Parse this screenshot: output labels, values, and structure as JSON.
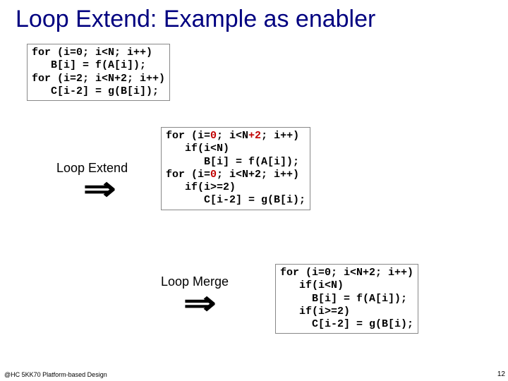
{
  "title": "Loop Extend: Example as enabler",
  "code_box_1": "for (i=0; i<N; i++)\n   B[i] = f(A[i]);\nfor (i=2; i<N+2; i++)\n   C[i-2] = g(B[i]);",
  "step1_label": "Loop Extend",
  "code_box_2_pre1": "for (i=",
  "code_box_2_hl1": "0",
  "code_box_2_pre2": "; i<N",
  "code_box_2_hl2": "+2",
  "code_box_2_pre3": "; i++)\n   if(i<N)\n      B[i] = f(A[i]);\nfor (i=",
  "code_box_2_hl3": "0",
  "code_box_2_pre4": "; i<N+2; i++)\n   if(i>=2)\n      C[i-2] = g(B[i);",
  "step2_label": "Loop Merge",
  "code_box_3": "for (i=0; i<N+2; i++)\n   if(i<N)\n     B[i] = f(A[i]);\n   if(i>=2)\n     C[i-2] = g(B[i);",
  "footer": "@HC 5KK70 Platform-based Design",
  "page_number": "12",
  "arrow_glyph": "⇒"
}
